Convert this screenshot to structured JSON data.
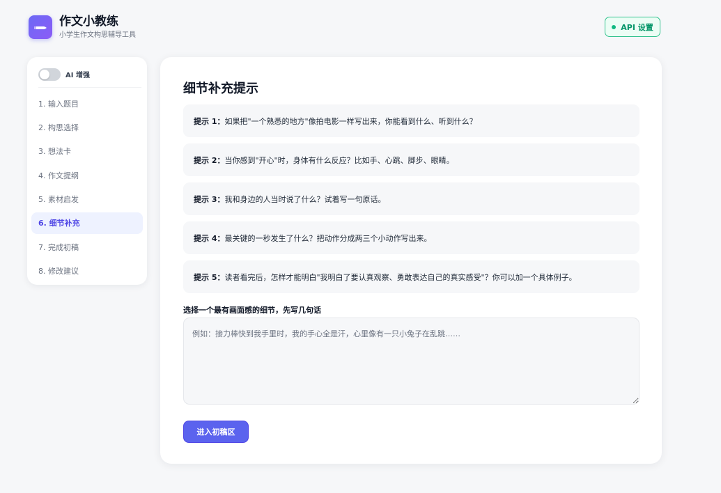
{
  "app": {
    "title": "作文小教练",
    "subtitle": "小学生作文构思辅导工具",
    "logo_icon": "pencil-icon",
    "accent_color": "#5b63ee"
  },
  "header": {
    "api_button_label": "API 设置",
    "api_status_color": "#10b981"
  },
  "sidebar": {
    "ai_toggle_label": "AI 增强",
    "ai_toggle_on": false,
    "items": [
      {
        "label": "1. 输入题目",
        "active": false
      },
      {
        "label": "2. 构思选择",
        "active": false
      },
      {
        "label": "3. 想法卡",
        "active": false
      },
      {
        "label": "4. 作文提纲",
        "active": false
      },
      {
        "label": "5. 素材启发",
        "active": false
      },
      {
        "label": "6. 细节补充",
        "active": true
      },
      {
        "label": "7. 完成初稿",
        "active": false
      },
      {
        "label": "8. 修改建议",
        "active": false
      }
    ]
  },
  "main": {
    "title": "细节补充提示",
    "hints": [
      {
        "label": "提示 1：",
        "text": "如果把\"一个熟悉的地方\"像拍电影一样写出来，你能看到什么、听到什么？"
      },
      {
        "label": "提示 2：",
        "text": "当你感到\"开心\"时，身体有什么反应？比如手、心跳、脚步、眼睛。"
      },
      {
        "label": "提示 3：",
        "text": "我和身边的人当时说了什么？试着写一句原话。"
      },
      {
        "label": "提示 4：",
        "text": "最关键的一秒发生了什么？把动作分成两三个小动作写出来。"
      },
      {
        "label": "提示 5：",
        "text": "读者看完后，怎样才能明白\"我明白了要认真观察、勇敢表达自己的真实感受\"？你可以加一个具体例子。"
      }
    ],
    "field_label": "选择一个最有画面感的细节，先写几句话",
    "textarea_value": "",
    "textarea_placeholder": "例如：接力棒快到我手里时，我的手心全是汗，心里像有一只小兔子在乱跳……",
    "next_button_label": "进入初稿区"
  }
}
